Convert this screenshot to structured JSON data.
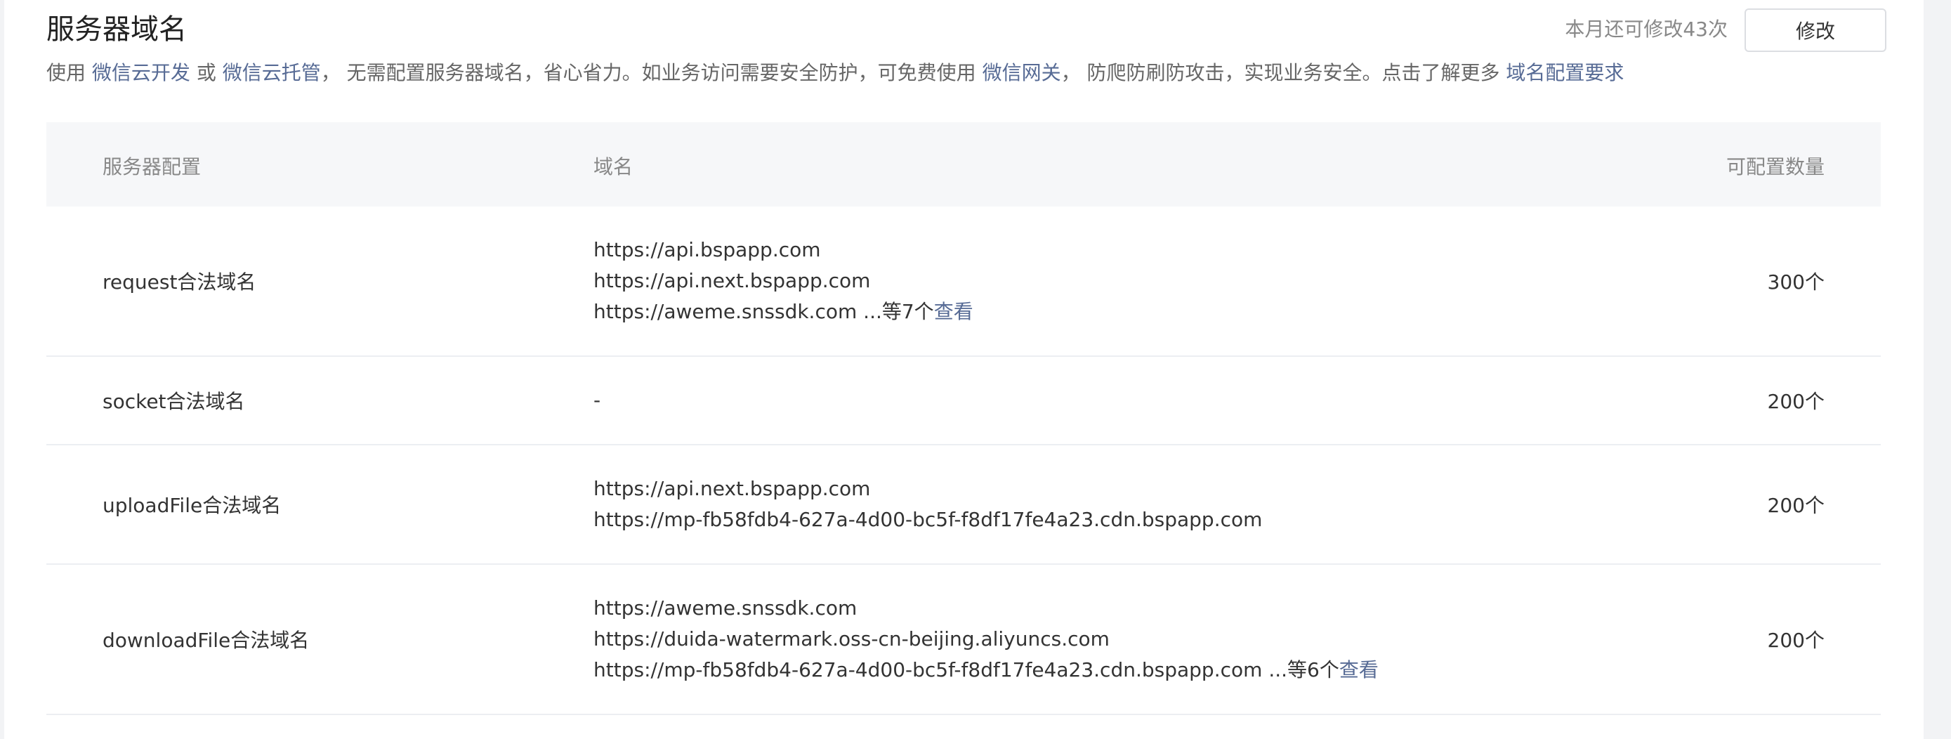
{
  "header": {
    "title": "服务器域名",
    "quota_text": "本月还可修改43次",
    "modify_label": "修改",
    "desc": {
      "t1": "使用 ",
      "link1": "微信云开发",
      "t2": " 或 ",
      "link2": "微信云托管",
      "t3": "， 无需配置服务器域名，省心省力。如业务访问需要安全防护，可免费使用 ",
      "link3": "微信网关",
      "t4": "， 防爬防刷防攻击，实现业务安全。点击了解更多 ",
      "link4": "域名配置要求"
    }
  },
  "table": {
    "headers": {
      "config": "服务器配置",
      "domain": "域名",
      "count": "可配置数量"
    },
    "rows": [
      {
        "name": "request合法域名",
        "domains": [
          "https://api.bspapp.com",
          "https://api.next.bspapp.com",
          "https://aweme.snssdk.com"
        ],
        "more_text": " ...等7个",
        "view_label": "查看",
        "count": "300个"
      },
      {
        "name": "socket合法域名",
        "domains": [
          "-"
        ],
        "count": "200个"
      },
      {
        "name": "uploadFile合法域名",
        "domains": [
          "https://api.next.bspapp.com",
          "https://mp-fb58fdb4-627a-4d00-bc5f-f8df17fe4a23.cdn.bspapp.com"
        ],
        "count": "200个"
      },
      {
        "name": "downloadFile合法域名",
        "domains": [
          "https://aweme.snssdk.com",
          "https://duida-watermark.oss-cn-beijing.aliyuncs.com",
          "https://mp-fb58fdb4-627a-4d00-bc5f-f8df17fe4a23.cdn.bspapp.com"
        ],
        "more_text": " ...等6个",
        "view_label": "查看",
        "count": "200个"
      }
    ]
  },
  "colors": {
    "link": "#576b95",
    "page_bg": "#f2f3f5",
    "header_row_bg": "#f6f7f9"
  }
}
